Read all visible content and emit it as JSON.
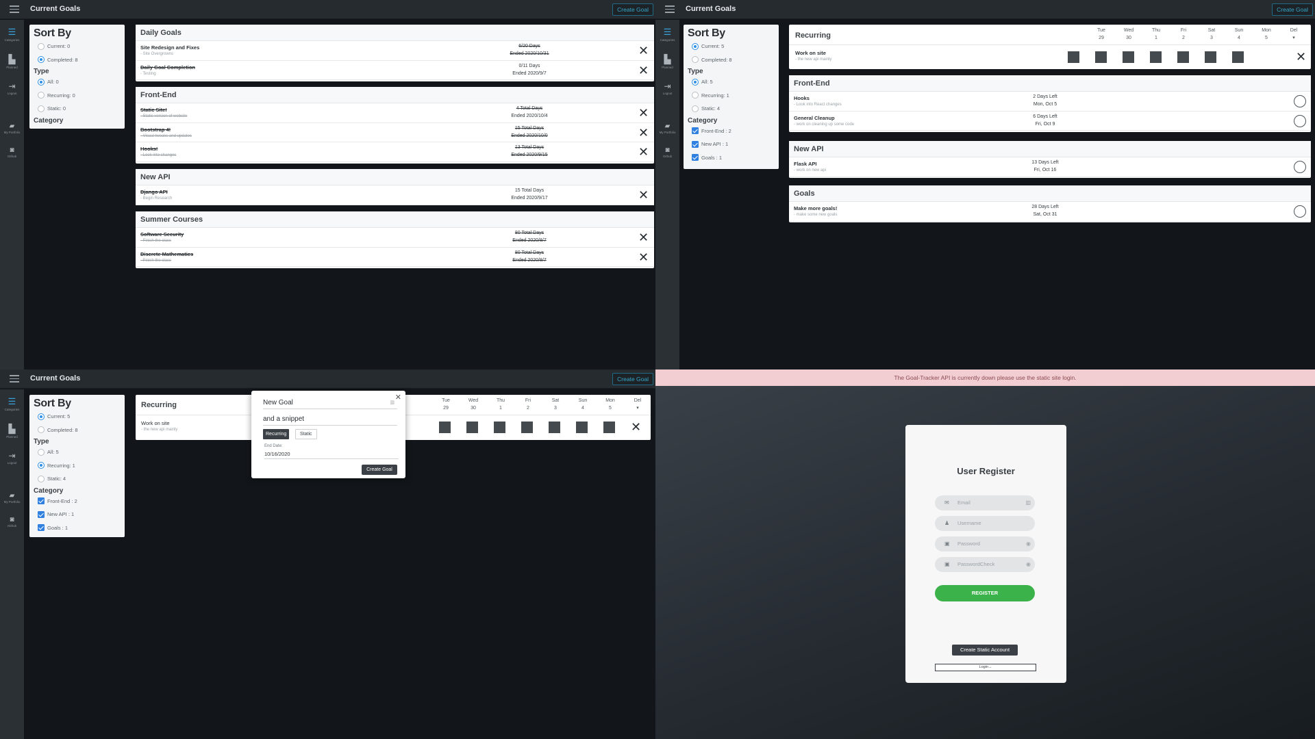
{
  "app": {
    "title": "Current Goals",
    "create_label": "Create Goal"
  },
  "nav": [
    {
      "label": "Categories",
      "icon": "list-icon"
    },
    {
      "label": "Planned",
      "icon": "map-icon"
    },
    {
      "label": "Logout",
      "icon": "logout-icon"
    },
    {
      "label": "My Portfolio",
      "icon": "portfolio-icon"
    },
    {
      "label": "Github",
      "icon": "github-icon"
    }
  ],
  "q1": {
    "sort": {
      "title": "Sort By",
      "current": "Current: 0",
      "completed": "Completed: 8",
      "type_label": "Type",
      "all": "All: 0",
      "recurring": "Recurring: 0",
      "static": "Static: 0",
      "category_label": "Category"
    },
    "groups": [
      {
        "title": "Daily Goals",
        "rows": [
          {
            "name": "Site Redesign and Fixes",
            "desc": "- Site Overgrowns",
            "c1": "6/20 Days",
            "c2": "Ended 2020/10/31"
          },
          {
            "name": "Daily Goal Completion",
            "desc": "- Testing",
            "c1": "0/11 Days",
            "c2": "Ended 2020/9/7"
          }
        ]
      },
      {
        "title": "Front-End",
        "rows": [
          {
            "name": "Static Site!",
            "desc": "- Static version of website",
            "c1": "4 Total Days",
            "c2": "Ended 2020/10/4"
          },
          {
            "name": "Bootstrap 4!",
            "desc": "- Visual tweaks and updates",
            "c1": "15 Total Days",
            "c2": "Ended 2020/10/0"
          },
          {
            "name": "Hooks!",
            "desc": "- Look into changes",
            "c1": "13 Total Days",
            "c2": "Ended 2020/9/15"
          }
        ]
      },
      {
        "title": "New API",
        "rows": [
          {
            "name": "Django API",
            "desc": "- Begin Research",
            "c1": "15 Total Days",
            "c2": "Ended 2020/9/17"
          }
        ]
      },
      {
        "title": "Summer Courses",
        "rows": [
          {
            "name": "Software Security",
            "desc": "- Finish the class",
            "c1": "80 Total Days",
            "c2": "Ended 2020/8/7"
          },
          {
            "name": "Discrete Mathematics",
            "desc": "- Finish the class",
            "c1": "80 Total Days",
            "c2": "Ended 2020/8/7"
          }
        ]
      }
    ]
  },
  "q2": {
    "sort": {
      "title": "Sort By",
      "current": "Current: 5",
      "completed": "Completed: 8",
      "type_label": "Type",
      "all": "All: 5",
      "recurring": "Recurring: 1",
      "static": "Static: 4",
      "category_label": "Category",
      "cat1": "Front-End : 2",
      "cat2": "New API : 1",
      "cat3": "Goals : 1"
    },
    "recurring": {
      "title": "Recurring",
      "days": [
        [
          "Tue",
          "29"
        ],
        [
          "Wed",
          "30"
        ],
        [
          "Thu",
          "1"
        ],
        [
          "Fri",
          "2"
        ],
        [
          "Sat",
          "3"
        ],
        [
          "Sun",
          "4"
        ],
        [
          "Mon",
          "5"
        ],
        [
          "Del",
          "▾"
        ]
      ],
      "row": {
        "name": "Work on site",
        "desc": "- the new api mainly"
      }
    },
    "groups": [
      {
        "title": "Front-End",
        "rows": [
          {
            "name": "Hooks",
            "desc": "- Look into React changes",
            "c1": "2 Days Left",
            "c2": "Mon, Oct 5"
          },
          {
            "name": "General Cleanup",
            "desc": "- work on cleaning up some code",
            "c1": "6 Days Left",
            "c2": "Fri, Oct 9"
          }
        ]
      },
      {
        "title": "New API",
        "rows": [
          {
            "name": "Flask API",
            "desc": "- work on new api",
            "c1": "13 Days Left",
            "c2": "Fri, Oct 16"
          }
        ]
      },
      {
        "title": "Goals",
        "rows": [
          {
            "name": "Make more goals!",
            "desc": "- make some new goals",
            "c1": "28 Days Left",
            "c2": "Sat, Oct 31"
          }
        ]
      }
    ]
  },
  "q3": {
    "sort": {
      "title": "Sort By",
      "current": "Current: 5",
      "completed": "Completed: 8",
      "type_label": "Type",
      "all": "All: 5",
      "recurring": "Recurring: 1",
      "static": "Static: 4",
      "category_label": "Category",
      "cat1": "Front-End : 2",
      "cat2": "New API : 1",
      "cat3": "Goals : 1"
    },
    "modal": {
      "title_value": "New Goal",
      "snippet_value": "and a snippet",
      "tab_recurring": "Recurring",
      "tab_static": "Static",
      "end_label": "End Date:",
      "end_value": "10/16/2020",
      "submit": "Create Goal"
    }
  },
  "q4": {
    "banner": "The Goal-Tracker API is currently down please use the static site login.",
    "title": "User Register",
    "email_ph": "Email",
    "username_ph": "Username",
    "password_ph": "Password",
    "password_check_ph": "PasswordCheck",
    "register": "REGISTER",
    "static_account": "Create Static Account",
    "login": "Login→"
  }
}
